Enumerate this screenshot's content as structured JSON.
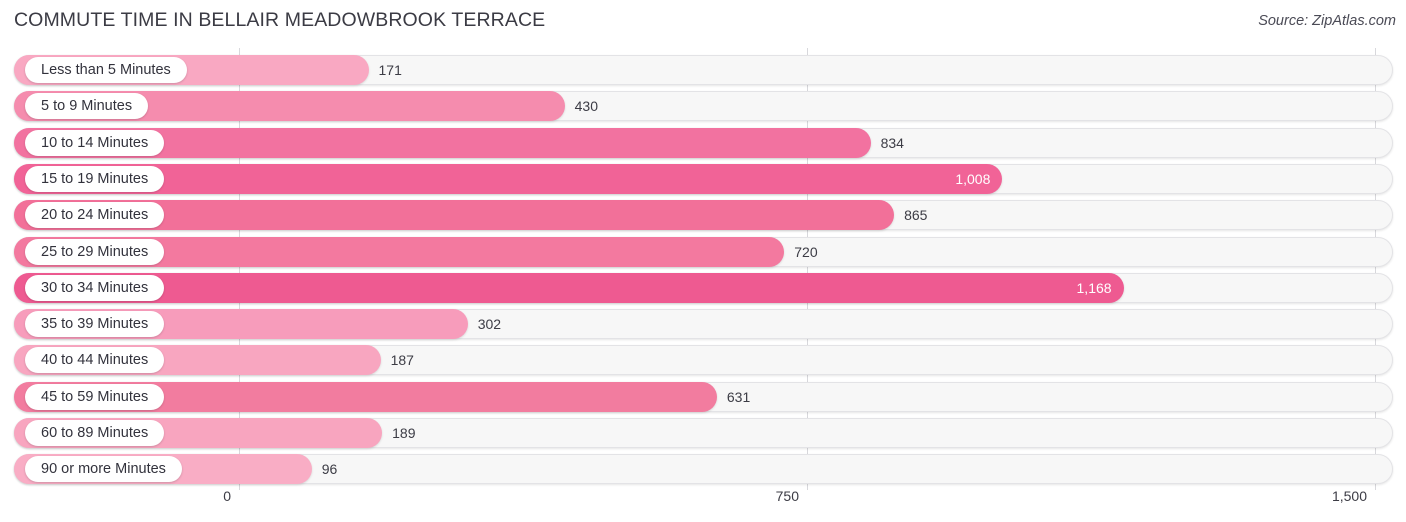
{
  "header": {
    "title": "COMMUTE TIME IN BELLAIR MEADOWBROOK TERRACE",
    "source": "Source: ZipAtlas.com"
  },
  "chart_data": {
    "type": "bar",
    "orientation": "horizontal",
    "title": "COMMUTE TIME IN BELLAIR MEADOWBROOK TERRACE",
    "subtitle": "",
    "xlabel": "",
    "ylabel": "",
    "xlim": [
      0,
      1500
    ],
    "xticks": [
      0,
      750,
      1500
    ],
    "xtick_labels": [
      "0",
      "750",
      "1,500"
    ],
    "grid": true,
    "legend": null,
    "categories": [
      "Less than 5 Minutes",
      "5 to 9 Minutes",
      "10 to 14 Minutes",
      "15 to 19 Minutes",
      "20 to 24 Minutes",
      "25 to 29 Minutes",
      "30 to 34 Minutes",
      "35 to 39 Minutes",
      "40 to 44 Minutes",
      "45 to 59 Minutes",
      "60 to 89 Minutes",
      "90 or more Minutes"
    ],
    "values": [
      171,
      430,
      834,
      1008,
      865,
      720,
      1168,
      302,
      187,
      631,
      189,
      96
    ],
    "value_labels": [
      "171",
      "430",
      "834",
      "1,008",
      "865",
      "720",
      "1,168",
      "302",
      "187",
      "631",
      "189",
      "96"
    ],
    "bar_colors": [
      "#f9a8c2",
      "#f58cae",
      "#f272a0",
      "#f16397",
      "#f27099",
      "#f3799f",
      "#ee5a91",
      "#f79cbb",
      "#f8a6c0",
      "#f27c9f",
      "#f8a5bf",
      "#f9adc5"
    ],
    "track_color": "#f7f7f7",
    "gridline_color": "#d8d8dc"
  }
}
